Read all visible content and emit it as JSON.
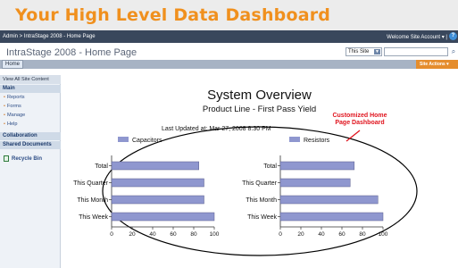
{
  "banner": {
    "title": "Your High Level Data Dashboard"
  },
  "topbar": {
    "breadcrumb": "Admin > IntraStage 2008 - Home Page",
    "welcome": "Welcome Site Account ▾ |"
  },
  "site": {
    "title": "IntraStage 2008 - Home Page",
    "search_scope": "This Site",
    "search_value": ""
  },
  "nav": {
    "home_tab": "Home",
    "site_actions": "Site Actions ▾"
  },
  "quicklaunch": {
    "view_all": "View All Site Content",
    "main_heading": "Main",
    "main_items": [
      "Reports",
      "Forms",
      "Manage",
      "Help"
    ],
    "collab_heading": "Collaboration",
    "shared_heading": "Shared Documents",
    "recycle_bin": "Recycle Bin"
  },
  "dashboard": {
    "title": "System Overview",
    "subtitle": "Product Line - First Pass Yield",
    "updated": "Last Updated at: Mar 27, 2008 8:30 PM",
    "annotation_line1": "Customized Home",
    "annotation_line2": "Page Dashboard"
  },
  "colors": {
    "accent_orange": "#f0901e",
    "bar_fill": "#8f97cf",
    "annotation_red": "#e0141e"
  },
  "chart_data": [
    {
      "type": "bar",
      "orientation": "horizontal",
      "series": [
        {
          "name": "Capacitors",
          "values": [
            85,
            90,
            90,
            100
          ]
        }
      ],
      "categories": [
        "Total",
        "This Quarter",
        "This Month",
        "This Week"
      ],
      "xlim": [
        0,
        100
      ],
      "xticks": [
        "0",
        "20",
        "40",
        "60",
        "80",
        "100"
      ],
      "legend": "top-left"
    },
    {
      "type": "bar",
      "orientation": "horizontal",
      "series": [
        {
          "name": "Resistors",
          "values": [
            72,
            68,
            95,
            100
          ]
        }
      ],
      "categories": [
        "Total",
        "This Quarter",
        "This Month",
        "This Week"
      ],
      "xlim": [
        0,
        100
      ],
      "xticks": [
        "0",
        "20",
        "40",
        "60",
        "80",
        "100"
      ],
      "legend": "top-left"
    }
  ]
}
